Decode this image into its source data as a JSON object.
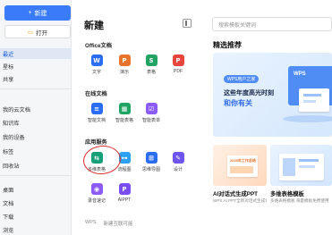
{
  "sidebar": {
    "new_label": "新建",
    "open_label": "打开",
    "items": [
      {
        "label": "最近"
      },
      {
        "label": "星标"
      },
      {
        "label": "共享"
      },
      {
        "label": "我的云文档"
      },
      {
        "label": "知识库"
      },
      {
        "label": "我的设备"
      },
      {
        "label": "标签"
      },
      {
        "label": "回收站"
      },
      {
        "label": "桌面"
      },
      {
        "label": "文档"
      },
      {
        "label": "下载"
      },
      {
        "label": "浏览"
      }
    ]
  },
  "main": {
    "title": "新建",
    "sections": [
      {
        "title": "Office文档",
        "apps": [
          {
            "label": "文字",
            "glyph": "W",
            "color": "#2b6df0"
          },
          {
            "label": "演示",
            "glyph": "P",
            "color": "#e8742b"
          },
          {
            "label": "表格",
            "glyph": "S",
            "color": "#1fa463"
          },
          {
            "label": "PDF",
            "glyph": "P",
            "color": "#e8453c"
          }
        ]
      },
      {
        "title": "在线文档",
        "apps": [
          {
            "label": "智能文档",
            "glyph": "≡",
            "color": "#2b6df0"
          },
          {
            "label": "智能表格",
            "glyph": "▦",
            "color": "#1fa463"
          },
          {
            "label": "智能表单",
            "glyph": "☑",
            "color": "#8a5cf5"
          }
        ]
      },
      {
        "title": "应用服务",
        "apps": [
          {
            "label": "多维表格",
            "glyph": "⇆",
            "color": "#16a07a"
          },
          {
            "label": "流程图",
            "glyph": "⊶",
            "color": "#2b9ff0"
          },
          {
            "label": "思维导图",
            "glyph": "⊞",
            "color": "#2b6df0"
          },
          {
            "label": "设计",
            "glyph": "✎",
            "color": "#6f55f0"
          },
          {
            "label": "录音速记",
            "glyph": "◉",
            "color": "#8a5cf5"
          },
          {
            "label": "AIPPT",
            "glyph": "P",
            "color": "#7a4df0"
          }
        ]
      }
    ],
    "footer": [
      "WPS",
      "新建互联可能"
    ]
  },
  "right": {
    "search_placeholder": "搜索模板关键词",
    "title": "精选推荐",
    "banner": {
      "tag": "WPS用户之家",
      "line1": "这些年度高光时刻",
      "line2": "和你有关",
      "screen_text": "WPS"
    },
    "cards": [
      {
        "mini_text": "2025年工作总结",
        "title": "AI对话式生成PPT",
        "subtitle": "WPS AI PPT全新对话式生成体验"
      },
      {
        "title": "多维表格模板",
        "subtitle": "多维表格模板 海量模板免费使用"
      }
    ]
  }
}
